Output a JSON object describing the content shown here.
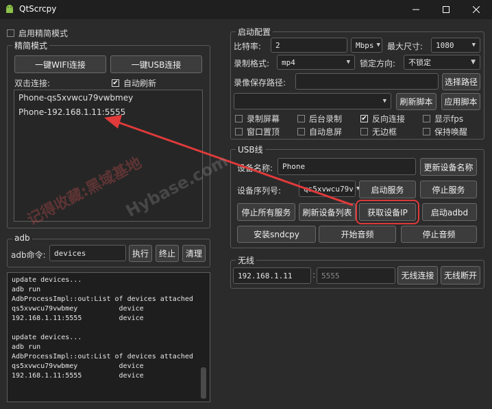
{
  "window": {
    "title": "QtScrcpy"
  },
  "left": {
    "simple_mode_label": "启用精简模式",
    "simple_group_title": "精简模式",
    "wifi_btn": "一键WIFI连接",
    "usb_btn": "一键USB连接",
    "dbl_click_label": "双击连接:",
    "auto_refresh_label": "自动刷新",
    "devices": [
      "Phone-qs5xvwcu79vwbmey",
      "Phone-192.168.1.11:5555"
    ],
    "adb_group_title": "adb",
    "adb_cmd_label": "adb命令:",
    "adb_cmd_value": "devices",
    "exec_btn": "执行",
    "stop_btn": "终止",
    "clear_btn": "清理",
    "console": "update devices...\nadb run\nAdbProcessImpl::out:List of devices attached\nqs5xvwcu79vwbmey          device\n192.168.1.11:5555         device\n\nupdate devices...\nadb run\nAdbProcessImpl::out:List of devices attached\nqs5xvwcu79vwbmey          device\n192.168.1.11:5555         device"
  },
  "config": {
    "group_title": "启动配置",
    "bitrate_label": "比特率:",
    "bitrate_value": "2",
    "bitrate_unit": "Mbps",
    "max_size_label": "最大尺寸:",
    "max_size_value": "1080",
    "record_fmt_label": "录制格式:",
    "record_fmt_value": "mp4",
    "lock_dir_label": "锁定方向:",
    "lock_dir_value": "不锁定",
    "save_path_label": "录像保存路径:",
    "select_path_btn": "选择路径",
    "refresh_script_btn": "刷新脚本",
    "apply_script_btn": "应用脚本",
    "checks": [
      {
        "label": "录制屏幕",
        "checked": false
      },
      {
        "label": "后台录制",
        "checked": false
      },
      {
        "label": "反向连接",
        "checked": true
      },
      {
        "label": "显示fps",
        "checked": false
      },
      {
        "label": "窗口置顶",
        "checked": false
      },
      {
        "label": "自动息屏",
        "checked": false
      },
      {
        "label": "无边框",
        "checked": false
      },
      {
        "label": "保持唤醒",
        "checked": false
      }
    ]
  },
  "usb": {
    "group_title": "USB线",
    "device_name_label": "设备名称:",
    "device_name_value": "Phone",
    "update_name_btn": "更新设备名称",
    "serial_label": "设备序列号:",
    "serial_value": "qs5xvwcu79v",
    "start_service_btn": "启动服务",
    "stop_service_btn": "停止服务",
    "stop_all_btn": "停止所有服务",
    "refresh_list_btn": "刷新设备列表",
    "get_ip_btn": "获取设备IP",
    "start_adbd_btn": "启动adbd",
    "install_sndcpy_btn": "安装sndcpy",
    "start_audio_btn": "开始音频",
    "stop_audio_btn": "停止音频"
  },
  "wireless": {
    "group_title": "无线",
    "ip_value": "192.168.1.11",
    "port_placeholder": "5555",
    "connect_btn": "无线连接",
    "disconnect_btn": "无线断开"
  },
  "watermark": {
    "text1": "记得收藏:黑域基地",
    "text2": "Hybase.com"
  },
  "colors": {
    "highlight": "#e03a3a",
    "background": "#2b2b2b"
  }
}
